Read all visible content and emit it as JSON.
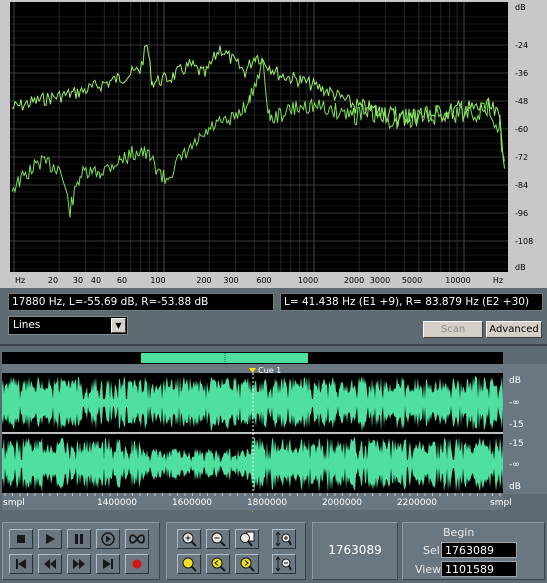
{
  "spectrum": {
    "db_ticks": [
      "dB",
      "-24",
      "-36",
      "-48",
      "-60",
      "-72",
      "-84",
      "-96",
      "-108",
      "dB"
    ],
    "freq_ticks": [
      "Hz",
      "20",
      "30",
      "40",
      "60",
      "100",
      "200",
      "300",
      "600",
      "1000",
      "2000",
      "3000",
      "5000",
      "10000",
      "Hz"
    ],
    "info_left": "17880 Hz, L=-55.69 dB, R=-53.88 dB",
    "info_right": "L= 41.438 Hz (E1 +9), R= 83.879 Hz (E2 +30)",
    "mode_select": "Lines",
    "scan_label": "Scan",
    "advanced_label": "Advanced",
    "line_color": "#9cf06a"
  },
  "waveform": {
    "cue_label": "Cue 1",
    "db_labels_top": [
      "dB",
      "-∞",
      "-15"
    ],
    "db_labels_bottom": [
      "-15",
      "-∞",
      "dB"
    ],
    "time_labels": [
      "smpl",
      "1400000",
      "1600000",
      "1800000",
      "2000000",
      "2200000",
      "smpl"
    ],
    "wave_color": "#4fe0a0"
  },
  "transport": {
    "position": "1763089",
    "begin_label": "Begin",
    "sel_label": "Sel",
    "sel_value": "1763089",
    "view_label": "View",
    "view_value": "1101589"
  }
}
